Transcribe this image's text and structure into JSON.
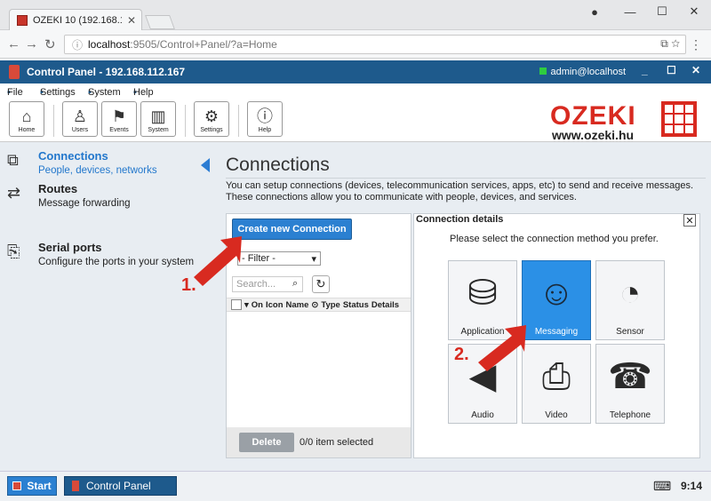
{
  "browser": {
    "tab_title": "OZEKI 10 (192.168.112.1…",
    "url_host": "localhost",
    "url_rest": ":9505/Control+Panel/?a=Home"
  },
  "app": {
    "title": "Control Panel - 192.168.112.167",
    "user": "admin@localhost"
  },
  "menu": {
    "items": [
      "File",
      "Settings",
      "System",
      "Help"
    ]
  },
  "toolbar": {
    "buttons": [
      "Home",
      "Users",
      "Events",
      "System",
      "Settings",
      "Help"
    ]
  },
  "logo": {
    "word": "OZEKI",
    "url": "www.ozeki.hu"
  },
  "sidebar": {
    "items": [
      {
        "title": "Connections",
        "desc": "People, devices, networks"
      },
      {
        "title": "Routes",
        "desc": "Message forwarding"
      },
      {
        "title": "Serial ports",
        "desc": "Configure the ports in your system"
      }
    ]
  },
  "main": {
    "title": "Connections",
    "description": "You can setup connections (devices, telecommunication services, apps, etc) to send and receive messages. These connections allow you to communicate with people, devices, and services.",
    "create_button": "Create new Connection",
    "filter": "- Filter -",
    "search_placeholder": "Search...",
    "columns": [
      "On",
      "Icon",
      "Name",
      "Type",
      "Status",
      "Details"
    ],
    "delete_button": "Delete",
    "selection_info": "0/0 item selected"
  },
  "details": {
    "title": "Connection details",
    "subtitle": "Please select the connection method you prefer.",
    "tiles": [
      "Application",
      "Messaging",
      "Sensor",
      "Audio",
      "Video",
      "Telephone"
    ],
    "selected": "Messaging"
  },
  "annotations": {
    "step1": "1.",
    "step2": "2."
  },
  "taskbar": {
    "start": "Start",
    "app": "Control Panel",
    "clock": "9:14"
  },
  "colors": {
    "accent": "#2b80d1",
    "header": "#1e5a8c",
    "brand_red": "#d82a20"
  }
}
